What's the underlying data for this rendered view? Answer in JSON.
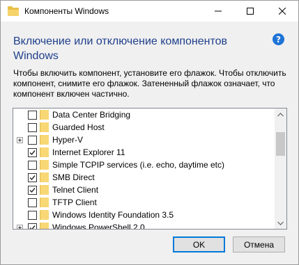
{
  "window": {
    "title": "Компоненты Windows",
    "icon": "windows-features-folder-icon"
  },
  "heading": "Включение или отключение компонентов Windows",
  "description": "Чтобы включить компонент, установите его флажок. Чтобы отключить компонент, снимите его флажок. Затененный флажок означает, что компонент включен частично.",
  "features": [
    {
      "label": "Data Center Bridging",
      "checked": false,
      "expandable": false
    },
    {
      "label": "Guarded Host",
      "checked": false,
      "expandable": false
    },
    {
      "label": "Hyper-V",
      "checked": false,
      "expandable": true
    },
    {
      "label": "Internet Explorer 11",
      "checked": true,
      "expandable": false
    },
    {
      "label": "Simple TCPIP services (i.e. echo, daytime etc)",
      "checked": false,
      "expandable": false
    },
    {
      "label": "SMB Direct",
      "checked": true,
      "expandable": false
    },
    {
      "label": "Telnet Client",
      "checked": true,
      "expandable": false
    },
    {
      "label": "TFTP Client",
      "checked": false,
      "expandable": false
    },
    {
      "label": "Windows Identity Foundation 3.5",
      "checked": false,
      "expandable": false
    },
    {
      "label": "Windows PowerShell 2.0",
      "checked": true,
      "expandable": true
    }
  ],
  "buttons": {
    "ok": "OK",
    "cancel": "Отмена"
  },
  "colors": {
    "heading": "#1f3f8c",
    "accent": "#0078d7",
    "folder": "#f8d775",
    "help": "#1e74d6"
  }
}
